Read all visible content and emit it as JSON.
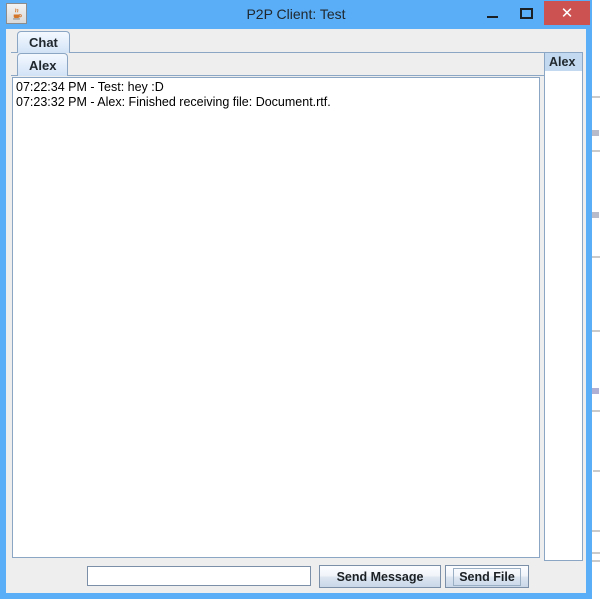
{
  "window": {
    "title": "P2P Client: Test",
    "app_icon": "java-coffee-cup-icon",
    "controls": {
      "minimize": "–",
      "maximize": "□",
      "close": "✕"
    },
    "colors": {
      "titlebar": "#5aaef7",
      "close_button": "#cc5252",
      "panel": "#eeeeee",
      "tab_border": "#8ba6c4",
      "selection": "#c3d9ef"
    }
  },
  "outer_tabs": [
    {
      "label": "Chat",
      "selected": true
    }
  ],
  "inner_tabs": [
    {
      "label": "Alex",
      "selected": true
    }
  ],
  "chat_log": {
    "lines": [
      "07:22:34 PM - Test: hey :D",
      "07:23:32 PM - Alex: Finished receiving file: Document.rtf."
    ]
  },
  "user_list": {
    "items": [
      {
        "label": "Alex",
        "selected": true
      }
    ]
  },
  "bottom_bar": {
    "message_input": {
      "value": "",
      "placeholder": ""
    },
    "send_message_label": "Send Message",
    "send_file_label": "Send File"
  }
}
